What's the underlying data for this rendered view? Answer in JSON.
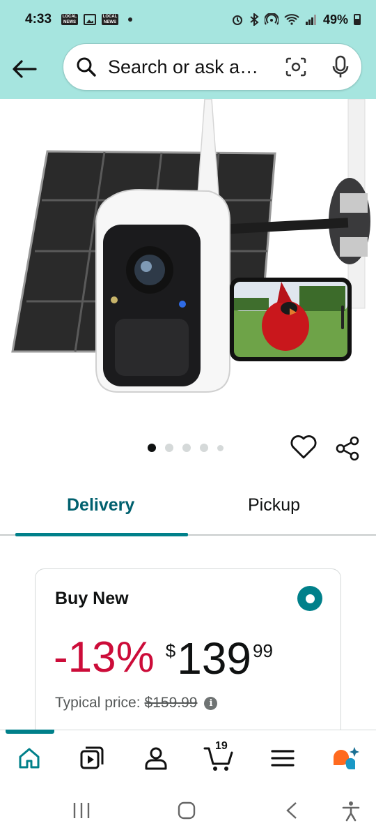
{
  "status_bar": {
    "time": "4:33",
    "news_badge": "LOCAL NEWS",
    "battery": "49%"
  },
  "header": {
    "search_placeholder": "Search or ask a question"
  },
  "carousel": {
    "count": 5,
    "active_index": 0
  },
  "tabs": [
    {
      "label": "Delivery",
      "selected": true
    },
    {
      "label": "Pickup",
      "selected": false
    }
  ],
  "buy_option": {
    "title": "Buy New",
    "discount": "-13%",
    "currency": "$",
    "price_whole": "139",
    "price_fraction": "99",
    "typical_label": "Typical price:",
    "typical_price": "$159.99"
  },
  "bottom_nav": {
    "cart_count": "19",
    "active": "home"
  },
  "colors": {
    "header_bg": "#a6e5df",
    "accent": "#00808a",
    "discount": "#cc0c39"
  }
}
